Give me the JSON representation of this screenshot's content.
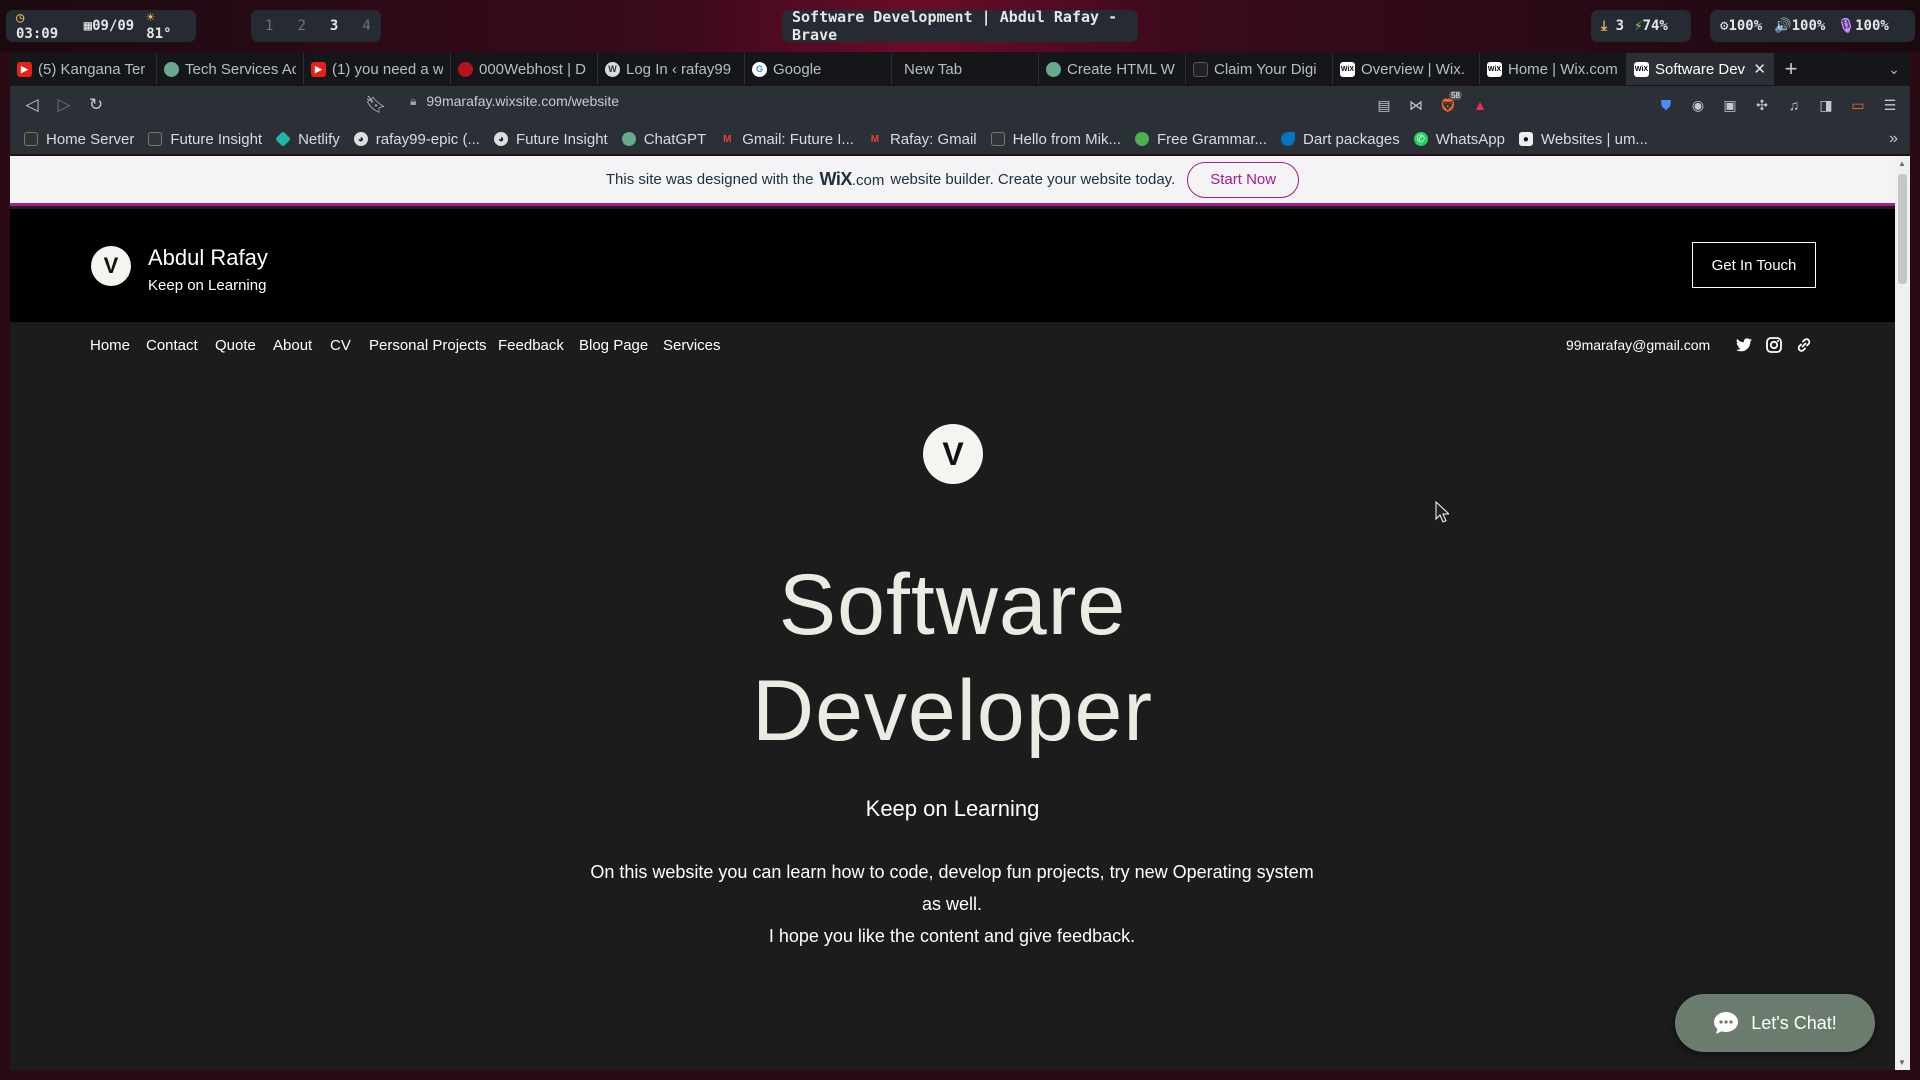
{
  "statusbar": {
    "time": "03:09",
    "date": "09/09",
    "temperature": "81°",
    "workspaces": [
      "1",
      "2",
      "3",
      "4"
    ],
    "active_workspace": "3",
    "window_title": "Software Development | Abdul Rafay - Brave",
    "downloads": "3",
    "battery": "74%",
    "brightness": "100%",
    "volume": "100%",
    "mic": "100%"
  },
  "tabs": [
    {
      "title": "(5) Kangana Ter",
      "icon": "youtube-icon",
      "color": "#e62117"
    },
    {
      "title": "Tech Services Ac",
      "icon": "chatgpt-icon",
      "color": "#6aa890"
    },
    {
      "title": "(1) you need a w",
      "icon": "youtube-icon",
      "color": "#e62117"
    },
    {
      "title": "000Webhost | D",
      "icon": "webhost-icon",
      "color": "#b5121b"
    },
    {
      "title": "Log In ‹ rafay99",
      "icon": "wordpress-icon",
      "color": "#d8dbe0"
    },
    {
      "title": "Google",
      "icon": "google-icon",
      "color": "#4285f4"
    },
    {
      "title": "New Tab",
      "icon": "",
      "color": ""
    },
    {
      "title": "Create HTML W",
      "icon": "chatgpt-icon",
      "color": "#6aa890"
    },
    {
      "title": "Claim Your Digi",
      "icon": "future-insight-icon",
      "color": "#222"
    },
    {
      "title": "Overview | Wix.",
      "icon": "wix-icon",
      "color": "#fff"
    },
    {
      "title": "Home | Wix.com",
      "icon": "wix-icon",
      "color": "#fff"
    },
    {
      "title": "Software Dev",
      "icon": "wix-icon",
      "color": "#fff",
      "active": true
    }
  ],
  "toolbar": {
    "url": "99marafay.wixsite.com/website",
    "brave_shield_count": "58"
  },
  "bookmarks": [
    {
      "label": "Home Server",
      "icon": "server-icon",
      "color": "#333"
    },
    {
      "label": "Future Insight",
      "icon": "future-insight-icon",
      "color": "#333"
    },
    {
      "label": "Netlify",
      "icon": "netlify-icon",
      "color": "#24b3a8"
    },
    {
      "label": "rafay99-epic (...",
      "icon": "github-icon",
      "color": "#ddd"
    },
    {
      "label": "Future Insight",
      "icon": "github-icon",
      "color": "#ddd"
    },
    {
      "label": "ChatGPT",
      "icon": "chatgpt-icon",
      "color": "#6aa890"
    },
    {
      "label": "Gmail: Future I...",
      "icon": "gmail-icon",
      "color": "#ea4335"
    },
    {
      "label": "Rafay: Gmail",
      "icon": "gmail-icon",
      "color": "#ea4335"
    },
    {
      "label": "Hello from Mik...",
      "icon": "mik-icon",
      "color": "#333"
    },
    {
      "label": "Free Grammar...",
      "icon": "grammar-icon",
      "color": "#4caf50"
    },
    {
      "label": "Dart packages",
      "icon": "dart-icon",
      "color": "#0175c2"
    },
    {
      "label": "WhatsApp",
      "icon": "whatsapp-icon",
      "color": "#25d366"
    },
    {
      "label": "Websites | um...",
      "icon": "websites-icon",
      "color": "#eee"
    }
  ],
  "wix_banner": {
    "text_before": "This site was designed with the",
    "brand": "WiX",
    "brand_suffix": ".com",
    "text_after": "website builder. Create your website today.",
    "button": "Start Now",
    "accent": "#a61b8e"
  },
  "site": {
    "logo_letter": "V",
    "name": "Abdul Rafay",
    "tagline": "Keep on Learning",
    "cta": "Get In Touch",
    "nav": [
      "Home",
      "Contact",
      "Quote",
      "About",
      "CV",
      "Personal Projects",
      "Feedback",
      "Blog Page",
      "Services"
    ],
    "email": "99marafay@gmail.com",
    "social": [
      "twitter-icon",
      "instagram-icon",
      "link-icon"
    ]
  },
  "hero": {
    "title_line1": "Software",
    "title_line2": "Developer",
    "subtitle": "Keep on Learning",
    "description_line1": "On this website you can learn how to code, develop fun projects, try new Operating system as well.",
    "description_line2": "I hope you like the content and give feedback."
  },
  "chat": {
    "label": "Let's Chat!",
    "color": "#6b7b6e"
  }
}
